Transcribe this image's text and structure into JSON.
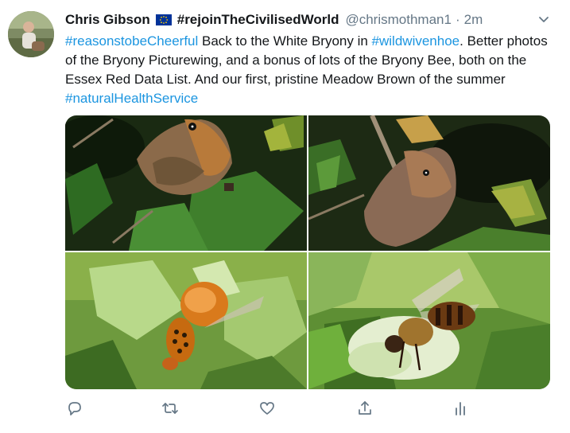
{
  "author": {
    "name": "Chris Gibson",
    "display_suffix": "#rejoinTheCivilisedWorld",
    "handle": "@chrismothman1",
    "separator": "·",
    "time": "2m"
  },
  "tweet": {
    "segments": [
      {
        "text": "#reasonstobeCheerful",
        "hashtag": true
      },
      {
        "text": " Back to the White Bryony in ",
        "hashtag": false
      },
      {
        "text": "#wildwivenhoe",
        "hashtag": true
      },
      {
        "text": ". Better photos of the Bryony Picturewing, and a bonus of lots of the Bryony Bee, both on the Essex Red Data List. And our first, pristine Meadow Brown of the summer ",
        "hashtag": false
      },
      {
        "text": "#naturalHealthService",
        "hashtag": true
      }
    ]
  },
  "colors": {
    "link": "#1b95e0",
    "secondary_text": "#657786",
    "flag_blue": "#003399",
    "flag_star": "#ffcc00"
  },
  "icons": {
    "caret": "chevron-down-icon",
    "reply": "reply-icon",
    "retweet": "retweet-icon",
    "like": "like-icon",
    "share": "share-icon",
    "analytics": "analytics-icon"
  }
}
